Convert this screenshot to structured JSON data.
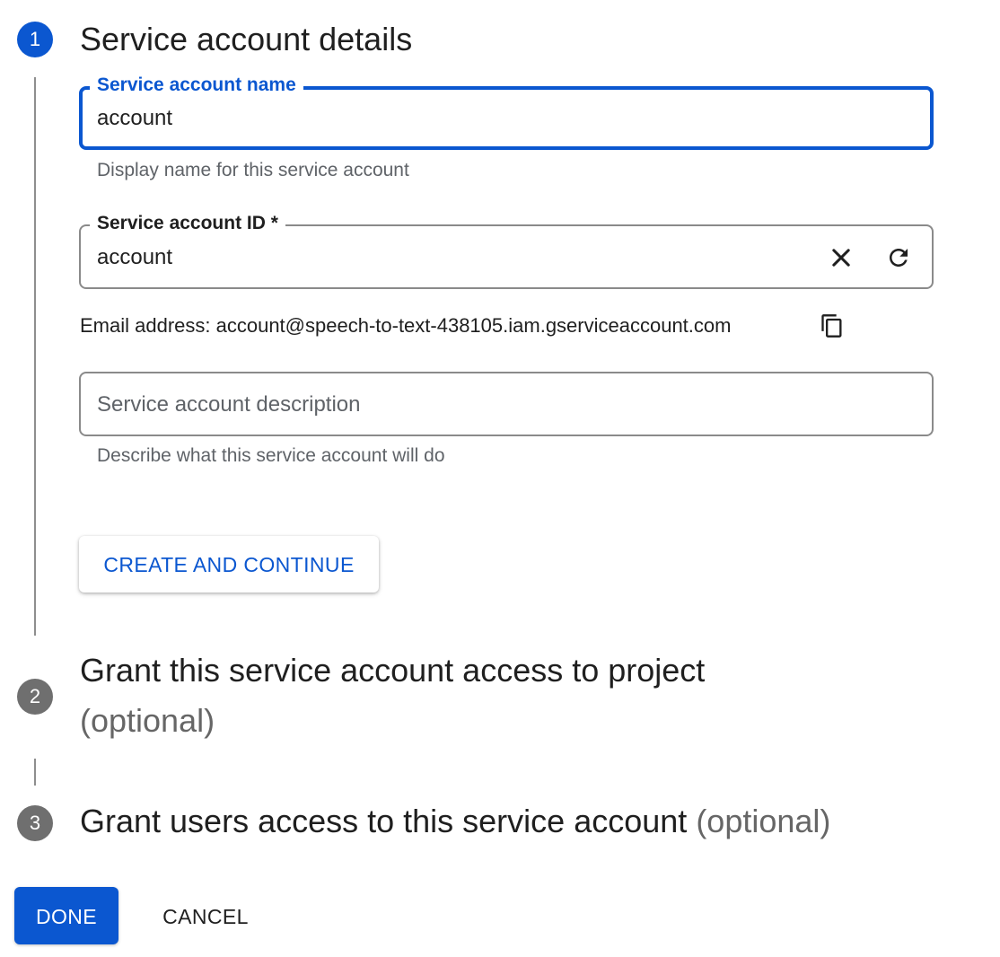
{
  "step1": {
    "number": "1",
    "title": "Service account details",
    "name_field": {
      "label": "Service account name",
      "value": "account",
      "helper": "Display name for this service account"
    },
    "id_field": {
      "label": "Service account ID *",
      "value": "account",
      "clear_icon": "close-icon",
      "refresh_icon": "refresh-icon"
    },
    "email": {
      "text": "Email address: account@speech-to-text-438105.iam.gserviceaccount.com",
      "copy_icon": "copy-icon"
    },
    "description_field": {
      "placeholder": "Service account description",
      "value": "",
      "helper": "Describe what this service account will do"
    },
    "create_button": "CREATE AND CONTINUE"
  },
  "step2": {
    "number": "2",
    "title": "Grant this service account access to project",
    "optional": "(optional)"
  },
  "step3": {
    "number": "3",
    "title": "Grant users access to this service account",
    "optional": "(optional)"
  },
  "footer": {
    "done": "DONE",
    "cancel": "CANCEL"
  },
  "colors": {
    "primary": "#0b57d0",
    "inactive_step": "#6f6f6f",
    "outline": "#8a8a8a",
    "helper_text": "#5f6368"
  }
}
